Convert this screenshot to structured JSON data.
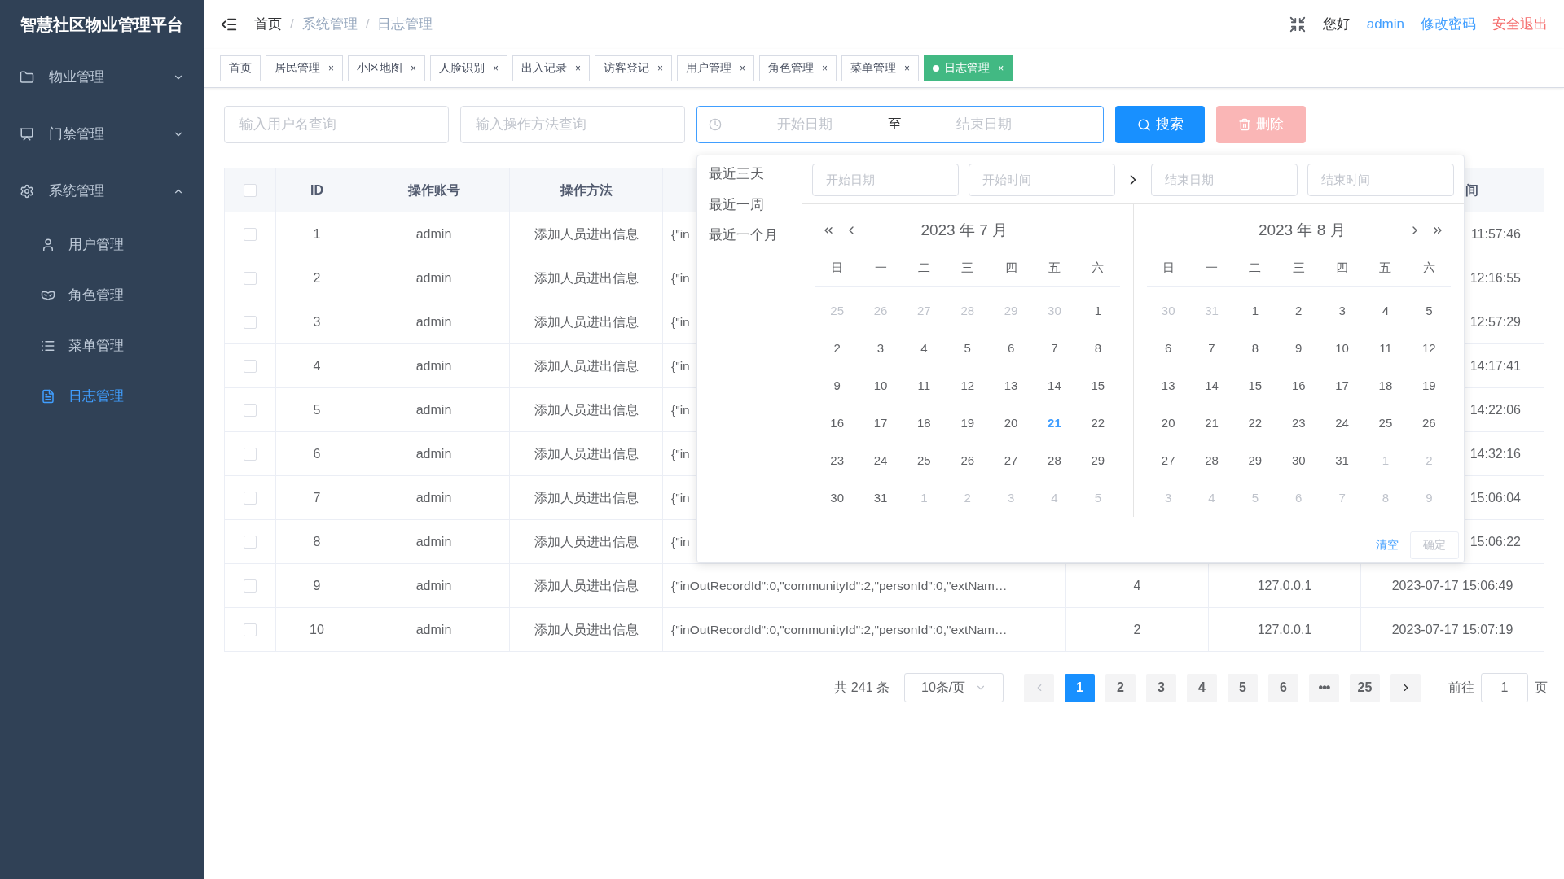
{
  "sidebar": {
    "title": "智慧社区物业管理平台",
    "items": [
      {
        "label": "物业管理",
        "expanded": false
      },
      {
        "label": "门禁管理",
        "expanded": false
      },
      {
        "label": "系统管理",
        "expanded": true,
        "children": [
          {
            "label": "用户管理",
            "selected": false
          },
          {
            "label": "角色管理",
            "selected": false
          },
          {
            "label": "菜单管理",
            "selected": false
          },
          {
            "label": "日志管理",
            "selected": true
          }
        ]
      }
    ]
  },
  "header": {
    "breadcrumb": [
      "首页",
      "系统管理",
      "日志管理"
    ],
    "separator": "/",
    "greeting": "您好",
    "user": "admin",
    "change_password": "修改密码",
    "logout": "安全退出"
  },
  "tabs": [
    {
      "label": "首页",
      "closable": false,
      "selected": false
    },
    {
      "label": "居民管理",
      "closable": true,
      "selected": false
    },
    {
      "label": "小区地图",
      "closable": true,
      "selected": false
    },
    {
      "label": "人脸识别",
      "closable": true,
      "selected": false
    },
    {
      "label": "出入记录",
      "closable": true,
      "selected": false
    },
    {
      "label": "访客登记",
      "closable": true,
      "selected": false
    },
    {
      "label": "用户管理",
      "closable": true,
      "selected": false
    },
    {
      "label": "角色管理",
      "closable": true,
      "selected": false
    },
    {
      "label": "菜单管理",
      "closable": true,
      "selected": false
    },
    {
      "label": "日志管理",
      "closable": true,
      "selected": true
    }
  ],
  "close_glyph": "×",
  "filters": {
    "username": {
      "placeholder": "输入用户名查询"
    },
    "method": {
      "placeholder": "输入操作方法查询"
    },
    "date_range": {
      "start_placeholder": "开始日期",
      "separator": "至",
      "end_placeholder": "结束日期"
    },
    "search_button": "搜索",
    "delete_button": "删除",
    "delete_disabled": true
  },
  "table": {
    "header_checked": false,
    "columns": {
      "id": "ID",
      "account": "操作账号",
      "method": "操作方法",
      "column_8": "间"
    },
    "rows": [
      {
        "kind": "partial",
        "checked": false,
        "id": "1",
        "account": "admin",
        "method": "添加人员进出信息",
        "params": "{\"in",
        "time": "11:57:46"
      },
      {
        "kind": "partial",
        "checked": false,
        "id": "2",
        "account": "admin",
        "method": "添加人员进出信息",
        "params": "{\"in",
        "time": "12:16:55"
      },
      {
        "kind": "partial",
        "checked": false,
        "id": "3",
        "account": "admin",
        "method": "添加人员进出信息",
        "params": "{\"in",
        "time": "12:57:29"
      },
      {
        "kind": "partial",
        "checked": false,
        "id": "4",
        "account": "admin",
        "method": "添加人员进出信息",
        "params": "{\"in",
        "time": "14:17:41"
      },
      {
        "kind": "partial",
        "checked": false,
        "id": "5",
        "account": "admin",
        "method": "添加人员进出信息",
        "params": "{\"in",
        "time": "14:22:06"
      },
      {
        "kind": "partial",
        "checked": false,
        "id": "6",
        "account": "admin",
        "method": "添加人员进出信息",
        "params": "{\"in",
        "time": "14:32:16"
      },
      {
        "kind": "partial",
        "checked": false,
        "id": "7",
        "account": "admin",
        "method": "添加人员进出信息",
        "params": "{\"in",
        "time": "15:06:04"
      },
      {
        "kind": "partial",
        "checked": false,
        "id": "8",
        "account": "admin",
        "method": "添加人员进出信息",
        "params": "{\"in",
        "time": "15:06:22"
      },
      {
        "kind": "full",
        "checked": false,
        "id": "9",
        "account": "admin",
        "method": "添加人员进出信息",
        "params": "{\"inOutRecordId\":0,\"communityId\":2,\"personId\":0,\"extNam…",
        "column_5": "4",
        "ip": "127.0.0.1",
        "time": "2023-07-17 15:06:49"
      },
      {
        "kind": "full",
        "checked": false,
        "id": "10",
        "account": "admin",
        "method": "添加人员进出信息",
        "params": "{\"inOutRecordId\":0,\"communityId\":2,\"personId\":0,\"extNam…",
        "column_5": "2",
        "ip": "127.0.0.1",
        "time": "2023-07-17 15:07:19"
      }
    ]
  },
  "date_picker": {
    "shortcuts": [
      "最近三天",
      "最近一周",
      "最近一个月"
    ],
    "inputs": {
      "start_date_placeholder": "开始日期",
      "start_time_placeholder": "开始时间",
      "end_date_placeholder": "结束日期",
      "end_time_placeholder": "结束时间"
    },
    "calendars": [
      {
        "title": "2023 年 7 月",
        "weekdays": [
          "日",
          "一",
          "二",
          "三",
          "四",
          "五",
          "六"
        ],
        "weeks": [
          [
            {
              "day": "25",
              "kind": "other"
            },
            {
              "day": "26",
              "kind": "other"
            },
            {
              "day": "27",
              "kind": "other"
            },
            {
              "day": "28",
              "kind": "other"
            },
            {
              "day": "29",
              "kind": "other"
            },
            {
              "day": "30",
              "kind": "other"
            },
            {
              "day": "1",
              "kind": "current"
            }
          ],
          [
            {
              "day": "2",
              "kind": "current"
            },
            {
              "day": "3",
              "kind": "current"
            },
            {
              "day": "4",
              "kind": "current"
            },
            {
              "day": "5",
              "kind": "current"
            },
            {
              "day": "6",
              "kind": "current"
            },
            {
              "day": "7",
              "kind": "current"
            },
            {
              "day": "8",
              "kind": "current"
            }
          ],
          [
            {
              "day": "9",
              "kind": "current"
            },
            {
              "day": "10",
              "kind": "current"
            },
            {
              "day": "11",
              "kind": "current"
            },
            {
              "day": "12",
              "kind": "current"
            },
            {
              "day": "13",
              "kind": "current"
            },
            {
              "day": "14",
              "kind": "current"
            },
            {
              "day": "15",
              "kind": "current"
            }
          ],
          [
            {
              "day": "16",
              "kind": "current"
            },
            {
              "day": "17",
              "kind": "current"
            },
            {
              "day": "18",
              "kind": "current"
            },
            {
              "day": "19",
              "kind": "current"
            },
            {
              "day": "20",
              "kind": "current"
            },
            {
              "day": "21",
              "kind": "today"
            },
            {
              "day": "22",
              "kind": "current"
            }
          ],
          [
            {
              "day": "23",
              "kind": "current"
            },
            {
              "day": "24",
              "kind": "current"
            },
            {
              "day": "25",
              "kind": "current"
            },
            {
              "day": "26",
              "kind": "current"
            },
            {
              "day": "27",
              "kind": "current"
            },
            {
              "day": "28",
              "kind": "current"
            },
            {
              "day": "29",
              "kind": "current"
            }
          ],
          [
            {
              "day": "30",
              "kind": "current"
            },
            {
              "day": "31",
              "kind": "current"
            },
            {
              "day": "1",
              "kind": "other"
            },
            {
              "day": "2",
              "kind": "other"
            },
            {
              "day": "3",
              "kind": "other"
            },
            {
              "day": "4",
              "kind": "other"
            },
            {
              "day": "5",
              "kind": "other"
            }
          ]
        ]
      },
      {
        "title": "2023 年 8 月",
        "weekdays": [
          "日",
          "一",
          "二",
          "三",
          "四",
          "五",
          "六"
        ],
        "weeks": [
          [
            {
              "day": "30",
              "kind": "other"
            },
            {
              "day": "31",
              "kind": "other"
            },
            {
              "day": "1",
              "kind": "current"
            },
            {
              "day": "2",
              "kind": "current"
            },
            {
              "day": "3",
              "kind": "current"
            },
            {
              "day": "4",
              "kind": "current"
            },
            {
              "day": "5",
              "kind": "current"
            }
          ],
          [
            {
              "day": "6",
              "kind": "current"
            },
            {
              "day": "7",
              "kind": "current"
            },
            {
              "day": "8",
              "kind": "current"
            },
            {
              "day": "9",
              "kind": "current"
            },
            {
              "day": "10",
              "kind": "current"
            },
            {
              "day": "11",
              "kind": "current"
            },
            {
              "day": "12",
              "kind": "current"
            }
          ],
          [
            {
              "day": "13",
              "kind": "current"
            },
            {
              "day": "14",
              "kind": "current"
            },
            {
              "day": "15",
              "kind": "current"
            },
            {
              "day": "16",
              "kind": "current"
            },
            {
              "day": "17",
              "kind": "current"
            },
            {
              "day": "18",
              "kind": "current"
            },
            {
              "day": "19",
              "kind": "current"
            }
          ],
          [
            {
              "day": "20",
              "kind": "current"
            },
            {
              "day": "21",
              "kind": "current"
            },
            {
              "day": "22",
              "kind": "current"
            },
            {
              "day": "23",
              "kind": "current"
            },
            {
              "day": "24",
              "kind": "current"
            },
            {
              "day": "25",
              "kind": "current"
            },
            {
              "day": "26",
              "kind": "current"
            }
          ],
          [
            {
              "day": "27",
              "kind": "current"
            },
            {
              "day": "28",
              "kind": "current"
            },
            {
              "day": "29",
              "kind": "current"
            },
            {
              "day": "30",
              "kind": "current"
            },
            {
              "day": "31",
              "kind": "current"
            },
            {
              "day": "1",
              "kind": "other"
            },
            {
              "day": "2",
              "kind": "other"
            }
          ],
          [
            {
              "day": "3",
              "kind": "other"
            },
            {
              "day": "4",
              "kind": "other"
            },
            {
              "day": "5",
              "kind": "other"
            },
            {
              "day": "6",
              "kind": "other"
            },
            {
              "day": "7",
              "kind": "other"
            },
            {
              "day": "8",
              "kind": "other"
            },
            {
              "day": "9",
              "kind": "other"
            }
          ]
        ]
      }
    ],
    "clear": "清空",
    "confirm": "确定",
    "confirm_disabled": true
  },
  "pagination": {
    "total": "共 241 条",
    "page_size": "10条/页",
    "prev_disabled": true,
    "pages": [
      {
        "label": "1",
        "kind": "page",
        "selected": true
      },
      {
        "label": "2",
        "kind": "page",
        "selected": false
      },
      {
        "label": "3",
        "kind": "page",
        "selected": false
      },
      {
        "label": "4",
        "kind": "page",
        "selected": false
      },
      {
        "label": "5",
        "kind": "page",
        "selected": false
      },
      {
        "label": "6",
        "kind": "page",
        "selected": false
      },
      {
        "label": "•••",
        "kind": "more",
        "selected": false
      },
      {
        "label": "25",
        "kind": "page",
        "selected": false
      }
    ],
    "goto_label": "前往",
    "goto_value": "1",
    "page_unit": "页"
  }
}
